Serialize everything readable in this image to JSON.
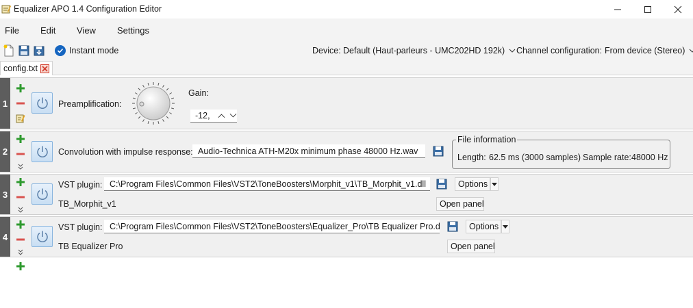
{
  "window": {
    "title": "Equalizer APO 1.4 Configuration Editor"
  },
  "menu": {
    "items": [
      "File",
      "Edit",
      "View",
      "Settings"
    ]
  },
  "toolbar": {
    "instant_mode_label": "Instant mode",
    "instant_mode_checked": true,
    "device_label": "Device:",
    "device_value": "Default (Haut-parleurs - UMC202HD 192k)",
    "channel_label": "Channel configuration:",
    "channel_value": "From device (Stereo)"
  },
  "tabs": [
    {
      "label": "config.txt"
    }
  ],
  "filters": {
    "preamp": {
      "number": "1",
      "label": "Preamplification:",
      "gain_label": "Gain:",
      "gain_value": "-12,"
    },
    "convolution": {
      "number": "2",
      "label": "Convolution with impulse response:",
      "file": "Audio-Technica ATH-M20x minimum phase 48000 Hz.wav",
      "info_title": "File information",
      "length_label": "Length:",
      "length_value": "62.5 ms (3000 samples)",
      "rate_label": "Sample rate:",
      "rate_value": "48000 Hz"
    },
    "vst1": {
      "number": "3",
      "label": "VST plugin:",
      "path": "C:\\Program Files\\Common Files\\VST2\\ToneBoosters\\Morphit_v1\\TB_Morphit_v1.dll",
      "options_label": "Options",
      "plugin_name": "TB_Morphit_v1",
      "open_panel_label": "Open panel"
    },
    "vst2": {
      "number": "4",
      "label": "VST plugin:",
      "path": "C:\\Program Files\\Common Files\\VST2\\ToneBoosters\\Equalizer_Pro\\TB Equalizer Pro.dll",
      "options_label": "Options",
      "plugin_name": "TB Equalizer Pro",
      "open_panel_label": "Open panel"
    }
  },
  "colors": {
    "accent_blue": "#1565c0",
    "add_green": "#2e9a2e",
    "remove_red": "#d9534f",
    "row_number_bg": "#5d5d5d"
  }
}
